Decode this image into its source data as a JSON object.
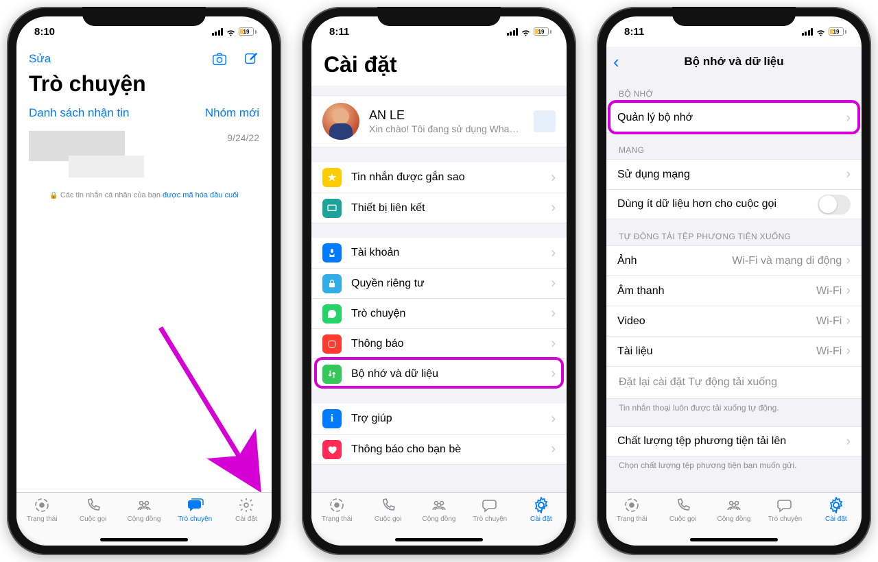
{
  "status": {
    "time1": "8:10",
    "time2": "8:11",
    "time3": "8:11",
    "battery": "19"
  },
  "s1": {
    "edit": "Sửa",
    "title": "Trò chuyện",
    "broadcast": "Danh sách nhận tin",
    "newgroup": "Nhóm mới",
    "date": "9/24/22",
    "enc_pre": "Các tin nhắn cá nhân của bạn ",
    "enc_link": "được mã hóa đầu cuối"
  },
  "s2": {
    "title": "Cài đặt",
    "name": "AN LE",
    "status": "Xin chào! Tôi đang sử dụng Wha…",
    "starred": "Tin nhắn được gắn sao",
    "linked": "Thiết bị liên kết",
    "account": "Tài khoản",
    "privacy": "Quyền riêng tư",
    "chats": "Trò chuyện",
    "notif": "Thông báo",
    "storage": "Bộ nhớ và dữ liệu",
    "help": "Trợ giúp",
    "tell": "Thông báo cho bạn bè"
  },
  "s3": {
    "title": "Bộ nhớ và dữ liệu",
    "h_storage": "BỘ NHỚ",
    "manage": "Quản lý bộ nhớ",
    "h_net": "MẠNG",
    "net_usage": "Sử dụng mạng",
    "less_data": "Dùng ít dữ liệu hơn cho cuộc gọi",
    "h_auto": "TỰ ĐỘNG TẢI TỆP PHƯƠNG TIỆN XUỐNG",
    "photos": "Ảnh",
    "photos_v": "Wi-Fi và mạng di động",
    "audio": "Âm thanh",
    "audio_v": "Wi-Fi",
    "video": "Video",
    "video_v": "Wi-Fi",
    "docs": "Tài liệu",
    "docs_v": "Wi-Fi",
    "reset": "Đặt lại cài đặt Tự động tải xuống",
    "voice_note": "Tin nhắn thoại luôn được tải xuống tự động.",
    "quality": "Chất lượng tệp phương tiện tải lên",
    "quality_note": "Chọn chất lượng tệp phương tiện bạn muốn gửi."
  },
  "tabs": {
    "status": "Trạng thái",
    "calls": "Cuộc gọi",
    "community": "Cộng đồng",
    "chats": "Trò chuyện",
    "settings": "Cài đặt"
  }
}
